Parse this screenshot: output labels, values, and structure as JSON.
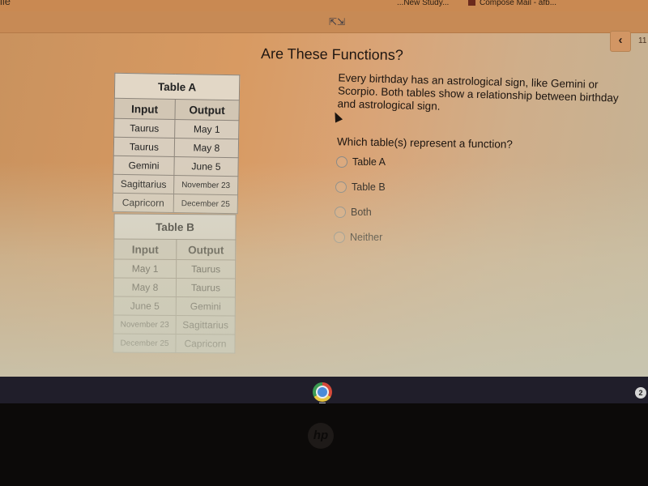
{
  "browser": {
    "bookmarks_left_fragment": "ile",
    "bookmarks": [
      {
        "label": "...New Study..."
      },
      {
        "label": "Compose Mail - afb..."
      }
    ],
    "expand_icon": "expand-arrows-icon",
    "back_icon": "chevron-left-icon",
    "page_number": "11"
  },
  "page": {
    "title": "Are These Functions?",
    "prompt": "Every birthday has an astrological sign, like Gemini or Scorpio. Both tables show a relationship between birthday and astrological sign.",
    "question": "Which table(s) represent a function?"
  },
  "tables": [
    {
      "title": "Table A",
      "headers": [
        "Input",
        "Output"
      ],
      "rows": [
        [
          "Taurus",
          "May 1"
        ],
        [
          "Taurus",
          "May 8"
        ],
        [
          "Gemini",
          "June 5"
        ],
        [
          "Sagittarius",
          "November 23"
        ],
        [
          "Capricorn",
          "December 25"
        ]
      ]
    },
    {
      "title": "Table B",
      "headers": [
        "Input",
        "Output"
      ],
      "rows": [
        [
          "May 1",
          "Taurus"
        ],
        [
          "May 8",
          "Taurus"
        ],
        [
          "June 5",
          "Gemini"
        ],
        [
          "November 23",
          "Sagittarius"
        ],
        [
          "December 25",
          "Capricorn"
        ]
      ]
    }
  ],
  "options": [
    {
      "label": "Table A",
      "selected": false
    },
    {
      "label": "Table B",
      "selected": false
    },
    {
      "label": "Both",
      "selected": false
    },
    {
      "label": "Neither",
      "selected": false
    }
  ],
  "shelf": {
    "app": "Chrome",
    "status_badge": "2"
  },
  "device": {
    "logo": "hp"
  }
}
